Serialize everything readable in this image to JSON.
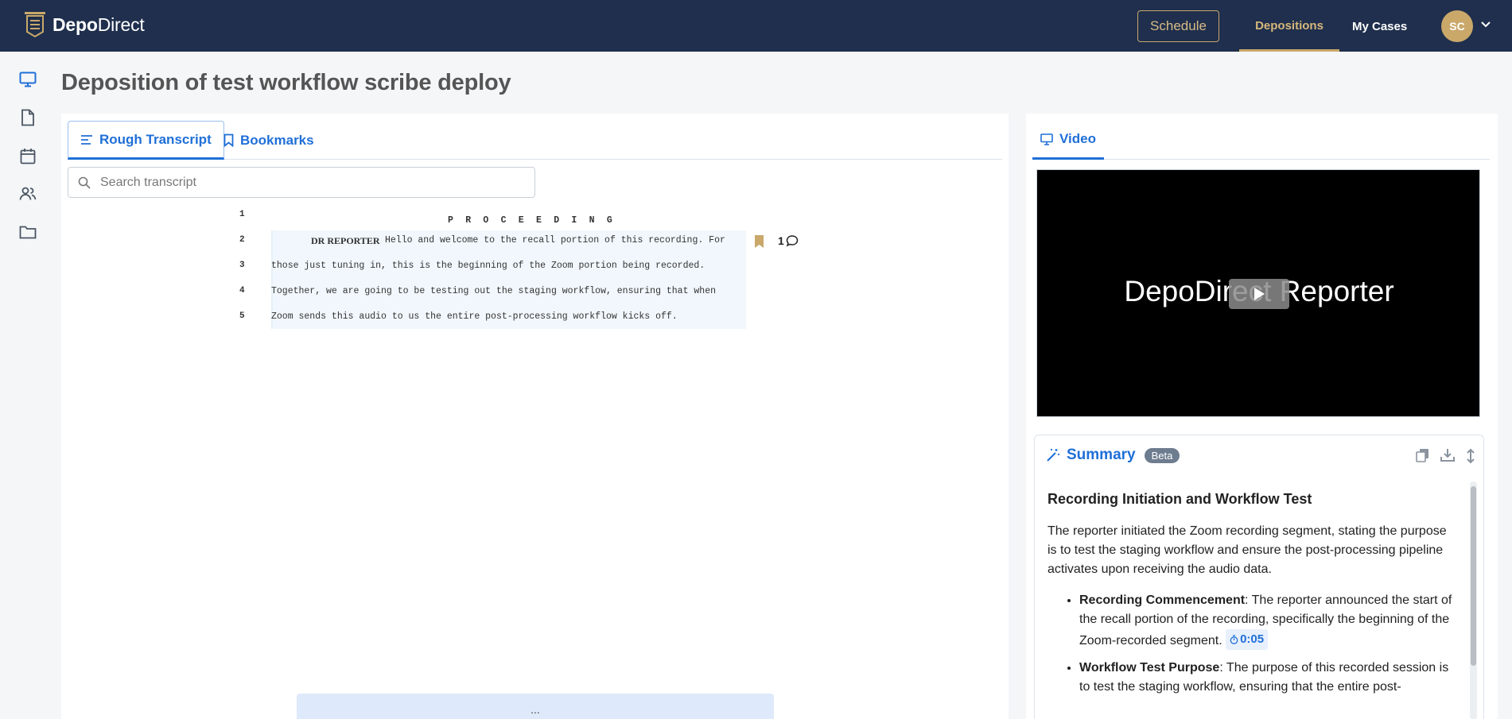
{
  "app": {
    "logo_bold": "Depo",
    "logo_regular": "Direct"
  },
  "header": {
    "schedule_label": "Schedule",
    "nav_depositions": "Depositions",
    "nav_my_cases": "My Cases",
    "avatar_initials": "SC"
  },
  "page": {
    "title": "Deposition of test workflow scribe deploy"
  },
  "transcript": {
    "tabs": [
      {
        "label": "Rough Transcript"
      },
      {
        "label": "Bookmarks"
      }
    ],
    "search_placeholder": "Search transcript",
    "heading": "P R O C E E D I N G",
    "line_numbers": [
      "1",
      "2",
      "3",
      "4",
      "5"
    ],
    "speaker": "DR REPORTER",
    "lines": [
      "Hello and welcome to the recall portion of this recording. For",
      "those just tuning in, this is the beginning of the Zoom portion being recorded.",
      "Together, we are going to be testing out the staging workflow, ensuring that when",
      "Zoom sends this audio to us the entire post-processing workflow kicks off."
    ],
    "comment_count": "1",
    "more_label": "..."
  },
  "video": {
    "tab_label": "Video",
    "overlay_text": "DepoDirect Reporter"
  },
  "summary": {
    "title": "Summary",
    "badge": "Beta",
    "section_title": "Recording Initiation and Workflow Test",
    "paragraph": "The reporter initiated the Zoom recording segment, stating the purpose is to test the staging workflow and ensure the post-processing pipeline activates upon receiving the audio data.",
    "bullets": [
      {
        "term": "Recording Commencement",
        "text": ": The reporter announced the start of the recall portion of the recording, specifically the beginning of the Zoom-recorded segment.",
        "timestamp": "0:05"
      },
      {
        "term": "Workflow Test Purpose",
        "text": ": The purpose of this recorded session is to test the staging workflow, ensuring that the entire post-",
        "timestamp": ""
      }
    ]
  },
  "colors": {
    "navy": "#1f2f4d",
    "gold": "#c9a86a",
    "accent_blue": "#1f6fd8"
  }
}
